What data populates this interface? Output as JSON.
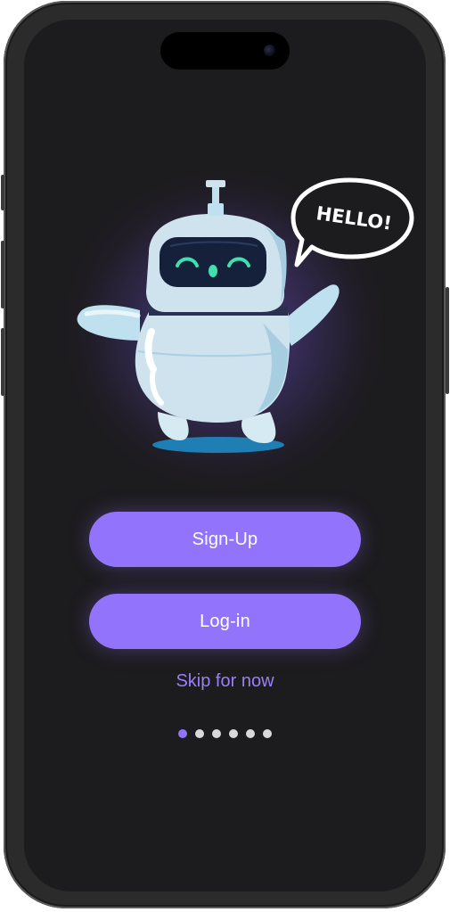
{
  "speech_bubble": {
    "text": "HELLO!"
  },
  "actions": {
    "signup_label": "Sign-Up",
    "login_label": "Log-in",
    "skip_label": "Skip for now"
  },
  "pagination": {
    "total": 6,
    "active_index": 0
  },
  "colors": {
    "accent": "#9174fb",
    "background": "#1c1b1d",
    "link": "#9b7ff9",
    "robot_body": "#cfe3ef",
    "robot_eyes": "#3fe0b0"
  },
  "icons": [
    "robot-mascot-icon",
    "speech-bubble-icon"
  ]
}
